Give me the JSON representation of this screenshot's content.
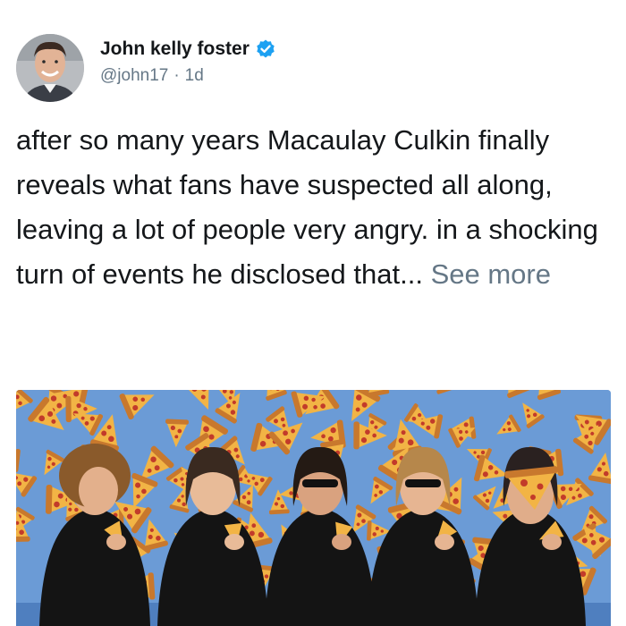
{
  "tweet": {
    "display_name": "John kelly foster",
    "handle": "@john17",
    "separator": "·",
    "time": "1d",
    "verified": true,
    "text": "after so many years Macaulay Culkin finally reveals what fans have suspected all along, leaving a lot of people very angry. in a shocking turn of events he disclosed that...",
    "see_more": "See more",
    "media_icon": "photo-people-eating-pizza"
  },
  "colors": {
    "text": "#14171a",
    "secondary": "#657786",
    "verified_badge": "#1da1f2",
    "media_background": "#6b9bd6"
  }
}
